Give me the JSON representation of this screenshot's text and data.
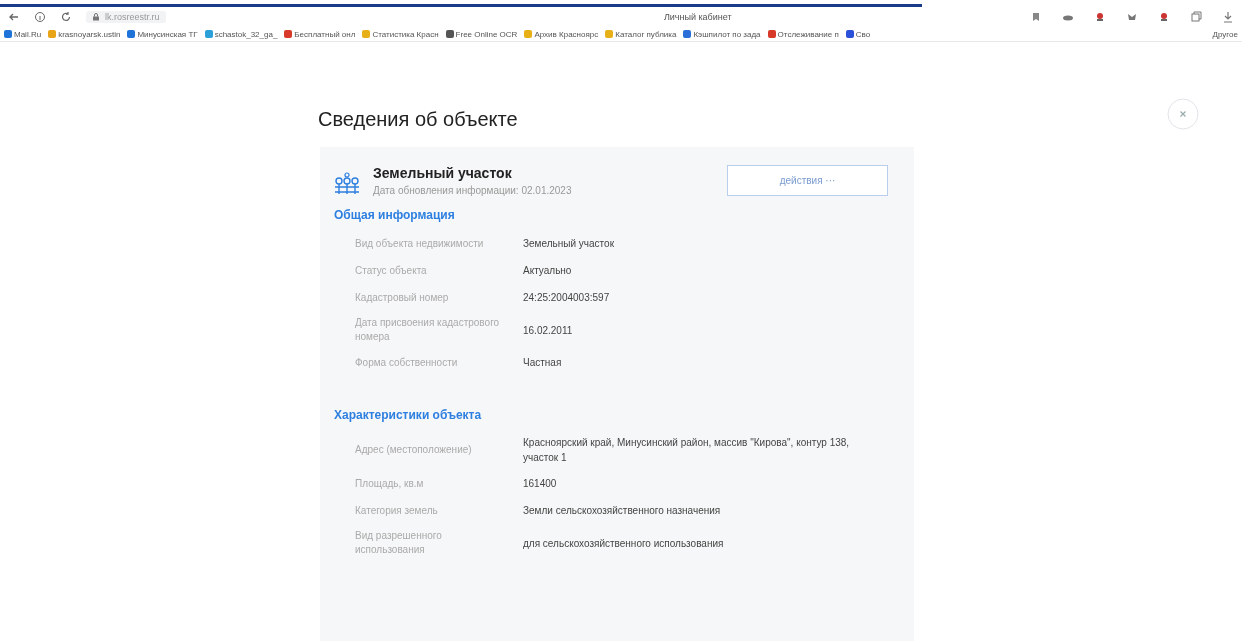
{
  "browser": {
    "address": "lk.rosreestr.ru",
    "title": "Личный кабинет",
    "bookmarks": [
      {
        "label": "Mail.Ru",
        "color": "#1e73d8"
      },
      {
        "label": "krasnoyarsk.ustin",
        "color": "#e8a317"
      },
      {
        "label": "Минусинская ТГ",
        "color": "#1e73d8"
      },
      {
        "label": "schastok_32_ga_",
        "color": "#2a9fd8"
      },
      {
        "label": "Бесплатный онл",
        "color": "#d83a2a"
      },
      {
        "label": "Статистика Красн",
        "color": "#e8b017"
      },
      {
        "label": "Free Online OCR",
        "color": "#555555"
      },
      {
        "label": "Архив Красноярс",
        "color": "#e8b017"
      },
      {
        "label": "Каталог публика",
        "color": "#e8b017"
      },
      {
        "label": "Кэшпилот по зада",
        "color": "#2a6fd8"
      },
      {
        "label": "Отслеживание п",
        "color": "#d83a2a"
      },
      {
        "label": "Сво",
        "color": "#2a4fd8"
      }
    ],
    "other_bookmarks": "Другое"
  },
  "page": {
    "title": "Сведения об объекте",
    "object": {
      "name": "Земельный участок",
      "updated": "Дата обновления информации: 02.01.2023",
      "actions_button": "действия ···"
    },
    "sections": [
      {
        "title": "Общая информация",
        "rows": [
          {
            "label": "Вид объекта недвижимости",
            "value": "Земельный участок"
          },
          {
            "label": "Статус объекта",
            "value": "Актуально"
          },
          {
            "label": "Кадастровый номер",
            "value": "24:25:2004003:597"
          },
          {
            "label": "Дата присвоения кадастрового номера",
            "value": "16.02.2011"
          },
          {
            "label": "Форма собственности",
            "value": "Частная"
          }
        ]
      },
      {
        "title": "Характеристики объекта",
        "rows": [
          {
            "label": "Адрес (местоположение)",
            "value": "Красноярский край, Минусинский район, массив \"Кирова\", контур 138, участок 1"
          },
          {
            "label": "Площадь, кв.м",
            "value": "161400"
          },
          {
            "label": "Категория земель",
            "value": "Земли сельскохозяйственного назначения"
          },
          {
            "label": "Вид разрешенного использования",
            "value": "для сельскохозяйственного использования"
          }
        ]
      }
    ]
  }
}
